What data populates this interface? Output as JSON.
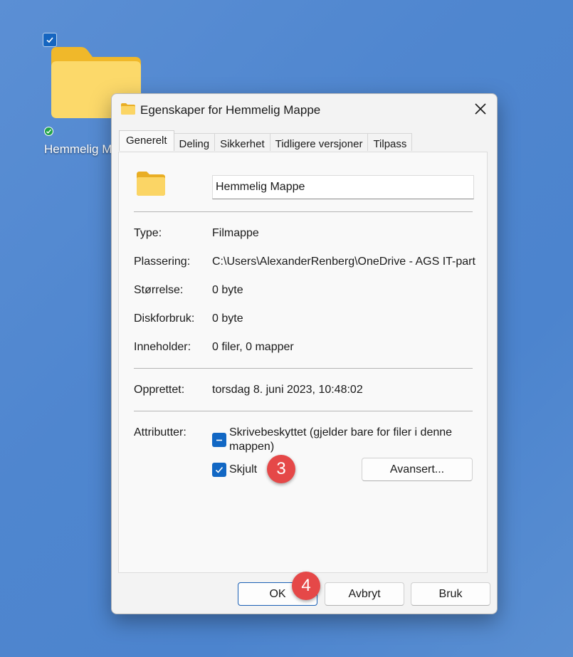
{
  "desktop": {
    "folder_label": "Hemmelig M",
    "icons": {
      "select": "checkbox-checked-icon",
      "folder": "folder-icon",
      "sync": "sync-ok-icon"
    }
  },
  "dialog": {
    "title": "Egenskaper for Hemmelig Mappe",
    "tabs": [
      {
        "label": "Generelt",
        "active": true
      },
      {
        "label": "Deling"
      },
      {
        "label": "Sikkerhet"
      },
      {
        "label": "Tidligere versjoner"
      },
      {
        "label": "Tilpass"
      }
    ],
    "name_value": "Hemmelig Mappe",
    "properties": [
      {
        "label": "Type:",
        "value": "Filmappe"
      },
      {
        "label": "Plassering:",
        "value": "C:\\Users\\AlexanderRenberg\\OneDrive - AGS IT-partner"
      },
      {
        "label": "Størrelse:",
        "value": "0 byte"
      },
      {
        "label": "Diskforbruk:",
        "value": "0 byte"
      },
      {
        "label": "Inneholder:",
        "value": "0 filer, 0 mapper"
      }
    ],
    "created": {
      "label": "Opprettet:",
      "value": "torsdag 8. juni 2023, 10:48:02"
    },
    "attributes": {
      "label": "Attributter:",
      "readonly_label_1": "Skrivebeskyttet (gjelder bare for filer i denne",
      "readonly_label_2": "mappen)",
      "readonly_state": "indeterminate",
      "hidden_label": "Skjult",
      "hidden_state": "checked",
      "advanced_button": "Avansert..."
    },
    "buttons": {
      "ok": "OK",
      "cancel": "Avbryt",
      "apply": "Bruk"
    }
  },
  "annotations": [
    {
      "label": "3"
    },
    {
      "label": "4"
    }
  ],
  "colors": {
    "accent": "#1167c4",
    "badge": "#e54848",
    "desktop": "#4f86cf"
  }
}
